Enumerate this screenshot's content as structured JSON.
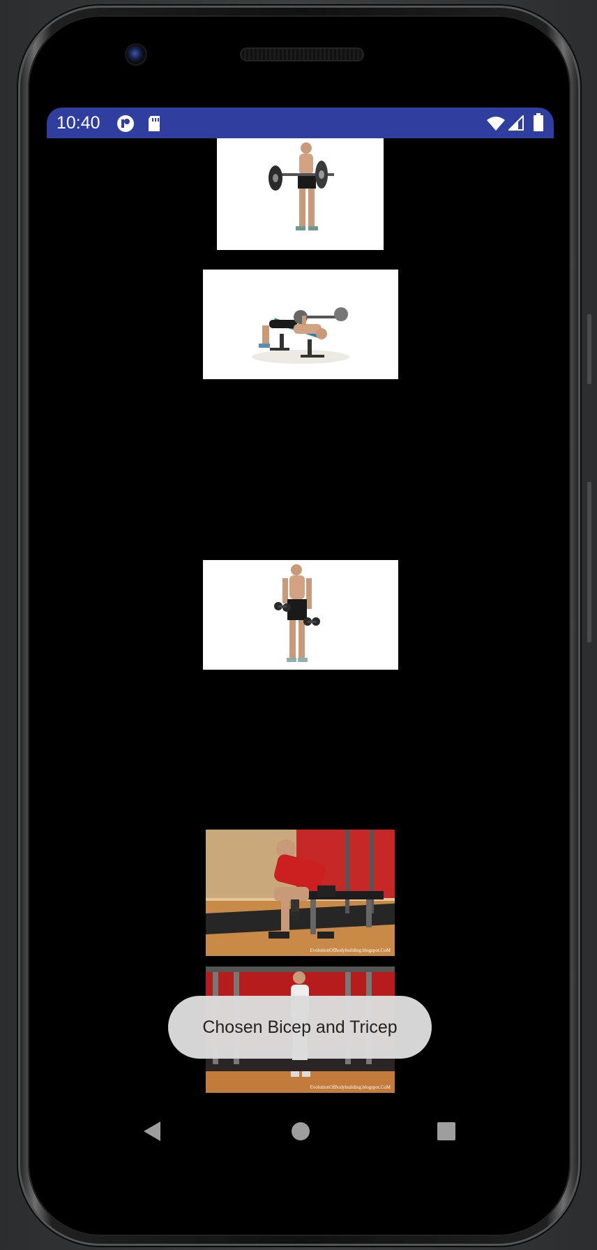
{
  "status_bar": {
    "time": "10:40",
    "icons": [
      "app-notification-icon",
      "sd-card-icon",
      "wifi-icon",
      "cellular-signal-icon",
      "battery-icon"
    ]
  },
  "exercises": [
    {
      "name": "barbell-curl",
      "background": "#ffffff"
    },
    {
      "name": "lying-triceps-extension",
      "background": "#ffffff"
    },
    {
      "name": "dumbbell-curl",
      "background": "#ffffff"
    },
    {
      "name": "concentration-curl",
      "background": "#c58a48",
      "watermark": "EvolutionOfBodybuilding.blogspot.CoM"
    },
    {
      "name": "standing-cable-exercise",
      "background": "#b71c1c",
      "watermark": "EvolutionOfBodybuilding.blogspot.CoM"
    }
  ],
  "toast": {
    "message": "Chosen Bicep and Tricep"
  },
  "nav_bar": {
    "icons": [
      "back-icon",
      "home-icon",
      "recents-icon"
    ]
  },
  "colors": {
    "status_bar": "#303f9f",
    "screen_background": "#000000",
    "toast_background": "#dcdcdc"
  }
}
